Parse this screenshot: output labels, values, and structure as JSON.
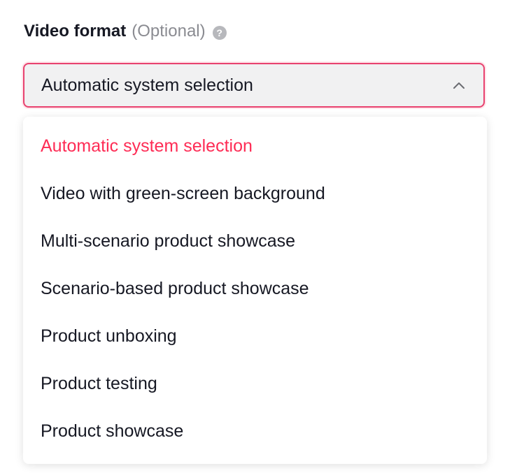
{
  "field": {
    "label": "Video format",
    "optional": "(Optional)",
    "help_icon": "question-circle-icon",
    "help_glyph": "?"
  },
  "select": {
    "value": "Automatic system selection",
    "chevron_icon": "chevron-up-icon",
    "expanded": true
  },
  "options": [
    {
      "label": "Automatic system selection",
      "selected": true
    },
    {
      "label": "Video with green-screen background",
      "selected": false
    },
    {
      "label": "Multi-scenario product showcase",
      "selected": false
    },
    {
      "label": "Scenario-based product showcase",
      "selected": false
    },
    {
      "label": "Product unboxing",
      "selected": false
    },
    {
      "label": "Product testing",
      "selected": false
    },
    {
      "label": "Product showcase",
      "selected": false
    }
  ],
  "colors": {
    "accent": "#fe2c55",
    "border_focus": "#e8426f",
    "text": "#161823",
    "muted": "#8a8b91",
    "select_bg": "#f1f1f2"
  }
}
